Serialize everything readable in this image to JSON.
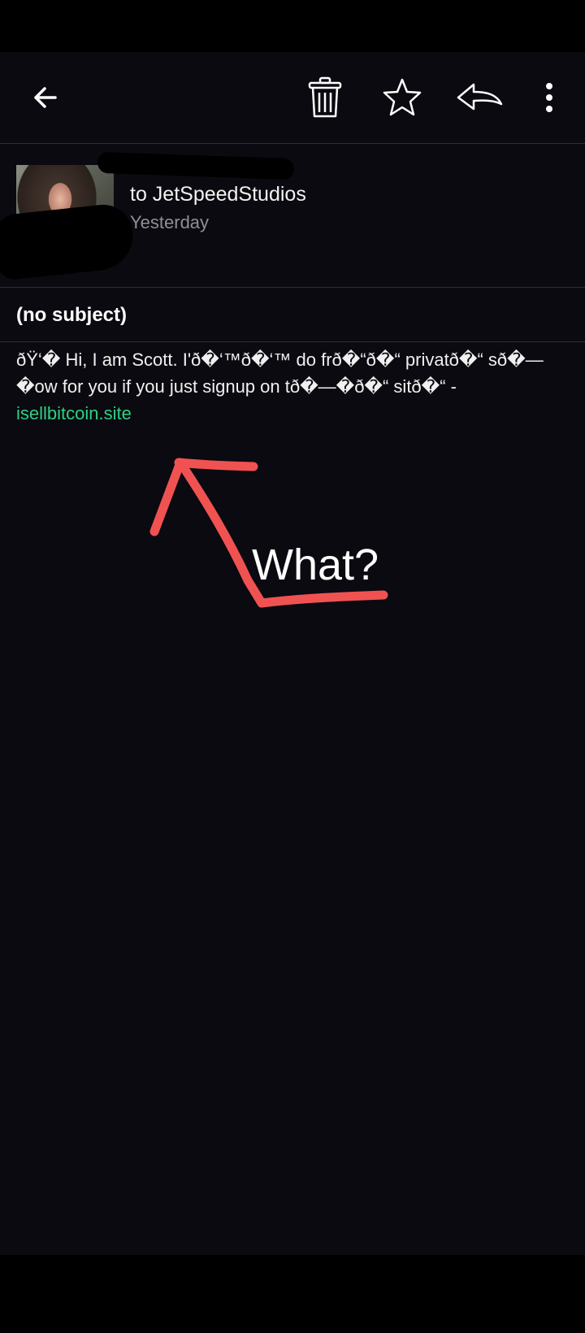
{
  "toolbar": {
    "back_icon": "arrow-left-icon",
    "delete_icon": "trash-icon",
    "star_icon": "star-outline-icon",
    "reply_icon": "reply-icon",
    "more_icon": "more-vertical-icon"
  },
  "header": {
    "recipient": "to JetSpeedStudios",
    "date": "Yesterday"
  },
  "message": {
    "subject": "(no subject)",
    "body": "ðŸ‘� Hi, I am Scott. I'ð�‘™ð�‘™ do frð�“ð�“ privatð�“ sð�—�ow for you if you just signup on tð�—�ð�“ sitð�“ - ",
    "link": "isellbitcoin.site"
  },
  "annotation": {
    "label": "What?",
    "color": "#f05252"
  },
  "colors": {
    "background": "#0a0a10",
    "divider": "#2c2d36",
    "link": "#2ecf82",
    "secondary_text": "#8e8f98"
  }
}
